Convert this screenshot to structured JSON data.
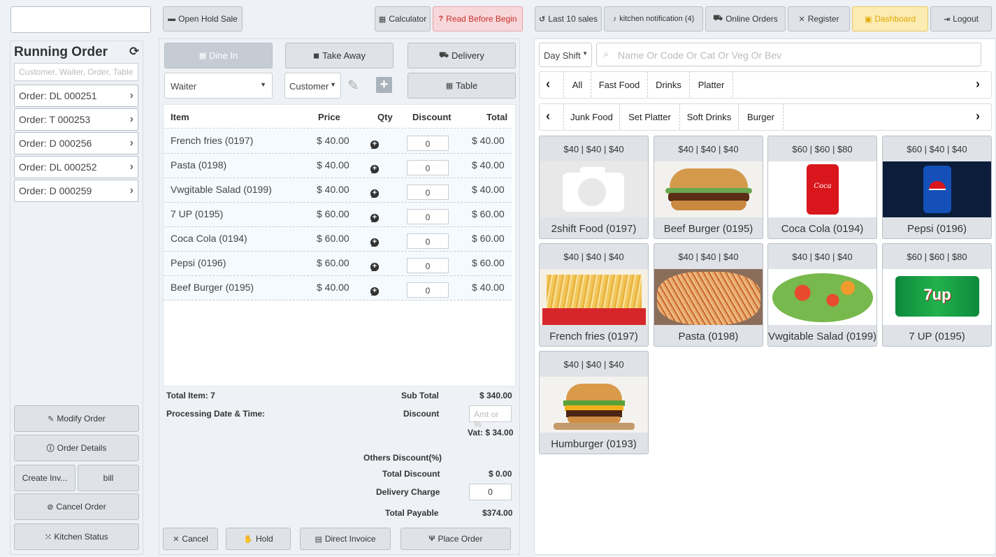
{
  "topbar": {
    "open_hold_sale": "Open Hold Sale",
    "calculator": "Calculator",
    "read_before_begin": "Read Before Begin",
    "last_10_sales": "Last 10 sales",
    "kitchen_notification": "kitchen notification (4)",
    "online_orders": "Online Orders",
    "register": "Register",
    "dashboard": "Dashboard",
    "logout": "Logout"
  },
  "running": {
    "title": "Running Order",
    "search_placeholder": "Customer, Waiter, Order, Table",
    "orders": [
      "Order: DL 000251",
      "Order: T 000253",
      "Order: D 000256",
      "Order: DL 000252",
      "Order: D 000259"
    ],
    "modify_order": "Modify Order",
    "order_details": "Order Details",
    "create_invoice": "Create Inv...",
    "bill": "bill",
    "cancel_order": "Cancel Order",
    "kitchen_status": "Kitchen Status"
  },
  "order": {
    "dine_in": "Dine In",
    "take_away": "Take Away",
    "delivery": "Delivery",
    "waiter": "Waiter",
    "customer": "Customer",
    "table": "Table",
    "headers": {
      "item": "Item",
      "price": "Price",
      "qty": "Qty",
      "discount": "Discount",
      "total": "Total"
    },
    "items": [
      {
        "name": "French fries (0197)",
        "price": "$ 40.00",
        "qty": "1",
        "discount": "0",
        "total": "$ 40.00"
      },
      {
        "name": "Pasta (0198)",
        "price": "$ 40.00",
        "qty": "1",
        "discount": "0",
        "total": "$ 40.00"
      },
      {
        "name": "Vwgitable Salad (0199)",
        "price": "$ 40.00",
        "qty": "1",
        "discount": "0",
        "total": "$ 40.00"
      },
      {
        "name": "7 UP (0195)",
        "price": "$ 60.00",
        "qty": "1",
        "discount": "0",
        "total": "$ 60.00"
      },
      {
        "name": "Coca Cola (0194)",
        "price": "$ 60.00",
        "qty": "1",
        "discount": "0",
        "total": "$ 60.00"
      },
      {
        "name": "Pepsi (0196)",
        "price": "$ 60.00",
        "qty": "1",
        "discount": "0",
        "total": "$ 60.00"
      },
      {
        "name": "Beef Burger (0195)",
        "price": "$ 40.00",
        "qty": "1",
        "discount": "0",
        "total": "$ 40.00"
      }
    ],
    "summary": {
      "total_item": "Total Item: 7",
      "processing": "Processing Date & Time:",
      "sub_total_label": "Sub Total",
      "sub_total": "$ 340.00",
      "discount_label": "Discount",
      "discount_placeholder": "Amt or %",
      "vat": "Vat: $ 34.00",
      "others_discount": "Others Discount(%)",
      "total_discount_label": "Total Discount",
      "total_discount": "$ 0.00",
      "delivery_charge_label": "Delivery Charge",
      "delivery_charge": "0",
      "total_payable_label": "Total Payable",
      "total_payable": "$374.00"
    },
    "cancel": "Cancel",
    "hold": "Hold",
    "direct_invoice": "Direct Invoice",
    "place_order": "Place Order"
  },
  "menu": {
    "shift": "Day Shift",
    "search_placeholder": "Name Or Code Or Cat Or Veg Or Bev",
    "categories1": [
      "All",
      "Fast Food",
      "Drinks",
      "Platter"
    ],
    "categories2": [
      "Junk Food",
      "Set Platter",
      "Soft Drinks",
      "Burger"
    ],
    "products": [
      {
        "price": "$40 | $40 | $40",
        "name": "2shift Food (0197)",
        "img": "camera-placeholder"
      },
      {
        "price": "$40 | $40 | $40",
        "name": "Beef Burger (0195)",
        "img": "burger"
      },
      {
        "price": "$60 | $60 | $80",
        "name": "Coca Cola (0194)",
        "img": "coca-cola"
      },
      {
        "price": "$60 | $40 | $40",
        "name": "Pepsi (0196)",
        "img": "pepsi"
      },
      {
        "price": "$40 | $40 | $40",
        "name": "French fries (0197)",
        "img": "fries"
      },
      {
        "price": "$40 | $40 | $40",
        "name": "Pasta (0198)",
        "img": "pasta"
      },
      {
        "price": "$40 | $40 | $40",
        "name": "Vwgitable Salad (0199)",
        "img": "salad"
      },
      {
        "price": "$60 | $60 | $80",
        "name": "7 UP (0195)",
        "img": "7up"
      },
      {
        "price": "$40 | $40 | $40",
        "name": "Humburger (0193)",
        "img": "humburger"
      }
    ]
  },
  "colors": {
    "read_before_bg": "#f8d7da",
    "read_before_text": "#c9302c",
    "dashboard_bg": "#fcebb3",
    "dashboard_text": "#e0a800"
  }
}
